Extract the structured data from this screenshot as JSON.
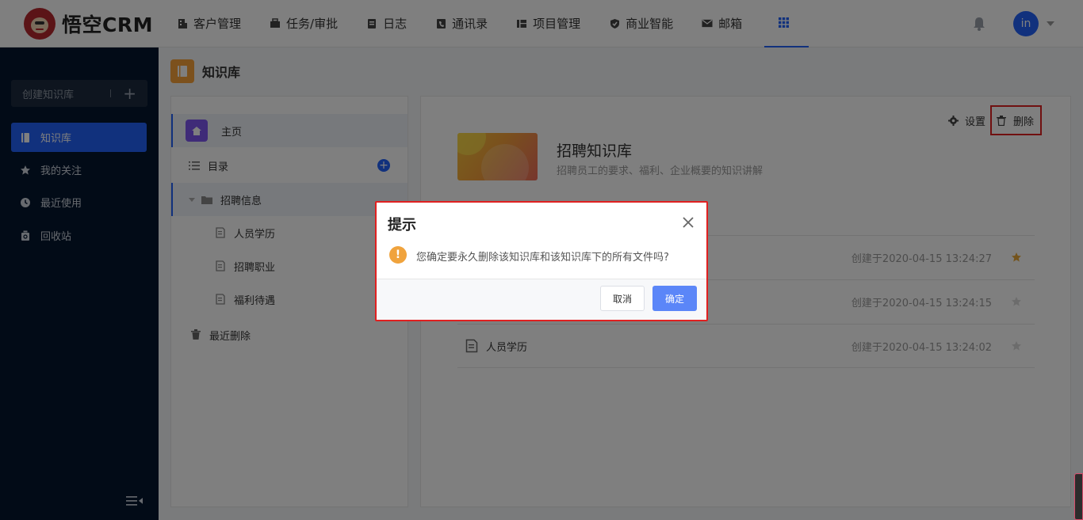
{
  "brand": {
    "name": "悟空CRM"
  },
  "nav": [
    {
      "label": "客户管理",
      "icon": "building-icon"
    },
    {
      "label": "任务/审批",
      "icon": "briefcase-icon"
    },
    {
      "label": "日志",
      "icon": "log-icon"
    },
    {
      "label": "通讯录",
      "icon": "phone-icon"
    },
    {
      "label": "项目管理",
      "icon": "project-icon"
    },
    {
      "label": "商业智能",
      "icon": "shield-icon"
    },
    {
      "label": "邮箱",
      "icon": "mail-icon"
    }
  ],
  "user": {
    "initials": "in"
  },
  "sidebar": {
    "create_label": "创建知识库",
    "items": [
      {
        "label": "知识库",
        "icon": "book-icon",
        "active": true
      },
      {
        "label": "我的关注",
        "icon": "star-icon"
      },
      {
        "label": "最近使用",
        "icon": "clock-icon"
      },
      {
        "label": "回收站",
        "icon": "recycle-icon"
      }
    ]
  },
  "page": {
    "title": "知识库"
  },
  "tree": {
    "home": "主页",
    "directory": "目录",
    "folder": "招聘信息",
    "files": [
      "人员学历",
      "招聘职业",
      "福利待遇"
    ],
    "recent_deleted": "最近删除"
  },
  "kb": {
    "title": "招聘知识库",
    "description": "招聘员工的要求、福利、企业概要的知识讲解",
    "settings_label": "设置",
    "delete_label": "删除",
    "documents": [
      {
        "name": "",
        "created": "创建于2020-04-15 13:24:27",
        "starred": true
      },
      {
        "name": "",
        "created": "创建于2020-04-15 13:24:15",
        "starred": false
      },
      {
        "name": "人员学历",
        "created": "创建于2020-04-15 13:24:02",
        "starred": false
      }
    ]
  },
  "dialog": {
    "title": "提示",
    "message": "您确定要永久删除该知识库和该知识库下的所有文件吗?",
    "cancel_label": "取消",
    "confirm_label": "确定"
  },
  "colors": {
    "primary": "#2362fb",
    "sidebar_bg": "#04162f",
    "warning": "#f0a33d",
    "highlight": "#e02020",
    "star": "#e8a93a"
  }
}
